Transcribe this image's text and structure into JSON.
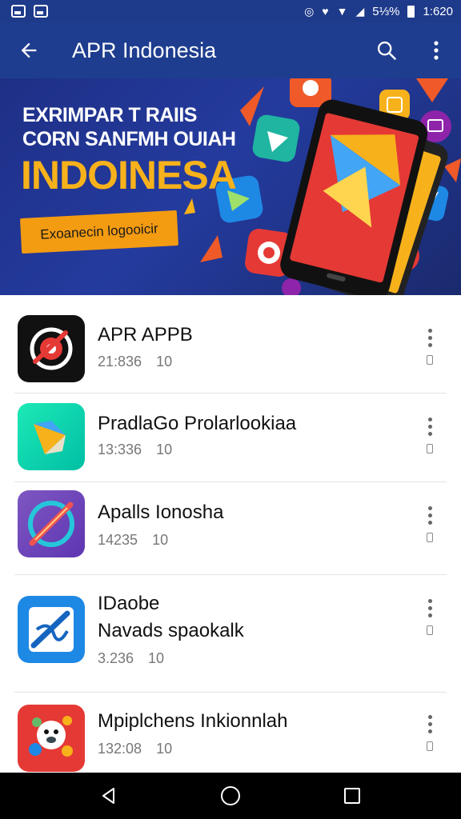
{
  "status_bar": {
    "battery_percent": "5⅓%",
    "time": "1:620",
    "colors": {
      "background": "#1e3a8a"
    }
  },
  "app_bar": {
    "title": "APR Indonesia",
    "background": "#1e3d8f"
  },
  "banner": {
    "line1": "EXRIMPAR T RAIIS",
    "line2": "CORN SANFMH OUIAH",
    "title": "INDOINESA",
    "cta": "Exoanecin logooicir",
    "title_color": "#f7b21b",
    "cta_color": "#f39c12"
  },
  "apps": [
    {
      "name": "APR APPB",
      "subtitle": "",
      "size": "21:836",
      "count": "10"
    },
    {
      "name": "PradlaGo Prolarlookiaa",
      "subtitle": "",
      "size": "13:336",
      "count": "10"
    },
    {
      "name": "Apalls Ionosha",
      "subtitle": "",
      "size": "14235",
      "count": "10"
    },
    {
      "name": "IDaobe",
      "subtitle": "Navads spaokalk",
      "size": "3.236",
      "count": "10"
    },
    {
      "name": "Mpiplchens Inkionnlah",
      "subtitle": "",
      "size": "132:08",
      "count": "10"
    }
  ],
  "icons": {
    "back": "arrow-left-icon",
    "search": "search-icon",
    "more": "more-vert-icon",
    "nav_back": "triangle-back-icon",
    "nav_home": "circle-home-icon",
    "nav_recents": "square-recents-icon"
  }
}
